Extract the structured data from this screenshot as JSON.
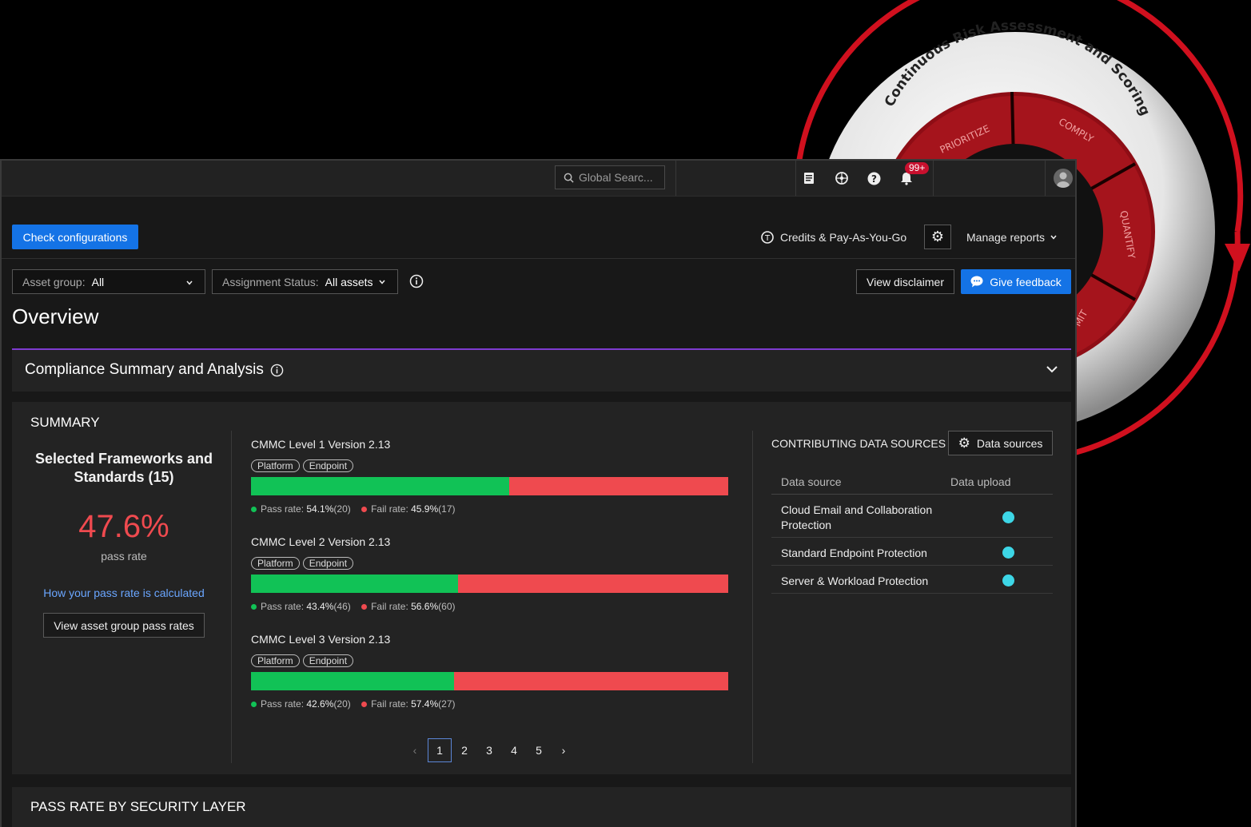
{
  "ring": {
    "title": "Continuous Risk Assessment and Scoring",
    "segments": [
      "PRIORITIZE",
      "COMPLY",
      "QUANTIFY",
      "MIT"
    ]
  },
  "topbar": {
    "search_placeholder": "Global Searc...",
    "notification_count": "99+",
    "icons": [
      "docs-icon",
      "network-icon",
      "help-icon",
      "bell-icon",
      "user-avatar"
    ]
  },
  "actions": {
    "check_configurations": "Check configurations",
    "credits": "Credits & Pay-As-You-Go",
    "manage_reports": "Manage reports"
  },
  "filters": {
    "asset_group_label": "Asset group:",
    "asset_group_value": "All",
    "assignment_label": "Assignment Status:",
    "assignment_value": "All assets",
    "view_disclaimer": "View disclaimer",
    "give_feedback": "Give feedback"
  },
  "page_title": "Overview",
  "section": {
    "title": "Compliance Summary and Analysis"
  },
  "summary": {
    "heading": "SUMMARY",
    "frameworks_title": "Selected Frameworks and Standards (15)",
    "pass_rate_value": "47.6%",
    "pass_rate_label": "pass rate",
    "calc_link": "How your pass rate is calculated",
    "view_asset_button": "View asset group pass rates"
  },
  "frameworks": [
    {
      "name": "CMMC Level 1 Version 2.13",
      "tags": [
        "Platform",
        "Endpoint"
      ],
      "pass_pct": 54.1,
      "pass_rate": "54.1%",
      "pass_count": "(20)",
      "fail_rate": "45.9%",
      "fail_count": "(17)"
    },
    {
      "name": "CMMC Level 2 Version 2.13",
      "tags": [
        "Platform",
        "Endpoint"
      ],
      "pass_pct": 43.4,
      "pass_rate": "43.4%",
      "pass_count": "(46)",
      "fail_rate": "56.6%",
      "fail_count": "(60)"
    },
    {
      "name": "CMMC Level 3 Version 2.13",
      "tags": [
        "Platform",
        "Endpoint"
      ],
      "pass_pct": 42.6,
      "pass_rate": "42.6%",
      "pass_count": "(20)",
      "fail_rate": "57.4%",
      "fail_count": "(27)"
    }
  ],
  "legend": {
    "pass_label": "Pass rate:",
    "fail_label": "Fail rate:"
  },
  "pagination": {
    "pages": [
      "1",
      "2",
      "3",
      "4",
      "5"
    ],
    "current": "1"
  },
  "data_sources": {
    "heading": "CONTRIBUTING DATA SOURCES",
    "button": "Data sources",
    "col_source": "Data source",
    "col_upload": "Data upload",
    "rows": [
      {
        "name": "Cloud Email and Collaboration Protection"
      },
      {
        "name": "Standard Endpoint Protection"
      },
      {
        "name": "Server & Workload Protection"
      }
    ]
  },
  "security_layer": {
    "heading": "PASS RATE BY SECURITY LAYER"
  },
  "colors": {
    "pass": "#11c256",
    "fail": "#ef4a4f",
    "accent": "#1473e6",
    "ring_red": "#d0101e",
    "status_dot": "#3dd6e6"
  }
}
